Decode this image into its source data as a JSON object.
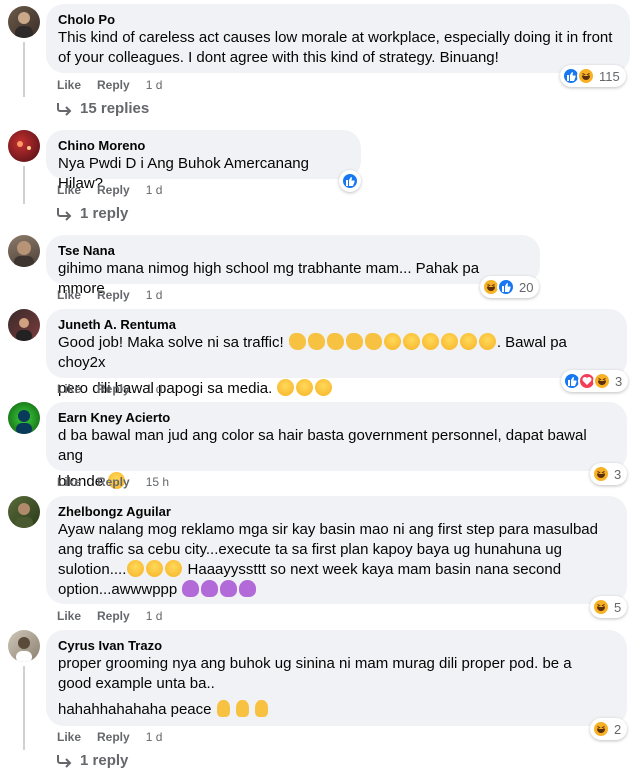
{
  "colors": {
    "bubble": "#f0f2f5",
    "secondary_text": "#65676b",
    "like_blue": "#1877f2",
    "love_red": "#f33e58",
    "haha_yellow": "#f7b125"
  },
  "comments": [
    {
      "author": "Cholo Po",
      "lines": [
        "This kind of careless act causes low morale at workplace, especially doing it in front of your colleagues. I dont agree with this kind of strategy. Binuang!"
      ],
      "like": "Like",
      "reply": "Reply",
      "time": "1 d",
      "reactions": {
        "icons": [
          "like-icon",
          "haha-icon"
        ],
        "count": "115"
      },
      "replies": "15 replies"
    },
    {
      "author": "Chino Moreno",
      "lines": [
        "Nya Pwdi D i Ang Buhok Amercanang Hilaw?"
      ],
      "like": "Like",
      "reply": "Reply",
      "time": "1 d",
      "reactions": {
        "icons": [
          "like-icon"
        ],
        "count": ""
      },
      "replies": "1 reply"
    },
    {
      "author": "Tse Nana",
      "lines": [
        "gihimo mana nimog high school mg trabhante mam... Pahak pa mmore"
      ],
      "like": "Like",
      "reply": "Reply",
      "time": "1 d",
      "reactions": {
        "icons": [
          "haha-icon",
          "like-icon"
        ],
        "count": "20"
      }
    },
    {
      "author": "Juneth A. Rentuma",
      "line1_text": "Good job! Maka solve ni sa traffic!",
      "line1_suffix": ". Bawal pa choy2x",
      "line2_text": "pero dili bawal papogi sa media.",
      "like": "Like",
      "reply": "Reply",
      "time": "1 d",
      "reactions": {
        "icons": [
          "like-icon",
          "love-icon",
          "haha-icon"
        ],
        "count": "3"
      }
    },
    {
      "author": "Earn Kney Acierto",
      "lines": [
        "d ba bawal man jud ang color sa hair basta government personnel, dapat bawal ang",
        "blonde"
      ],
      "like": "Like",
      "reply": "Reply",
      "time": "15 h",
      "reactions": {
        "icons": [
          "haha-icon"
        ],
        "count": "3"
      }
    },
    {
      "author": "Zhelbongz Aguilar",
      "lines": [
        "Ayaw nalang mog reklamo mga sir kay basin mao ni ang first step para masulbad",
        "ang traffic sa cebu city...execute ta sa first plan kapoy baya ug hunahuna ug"
      ],
      "line3_text": "sulotion....",
      "line3_suffix": " Haaayyssttt so next week kaya mam basin nana second",
      "line4_text": "option...awwwppp",
      "like": "Like",
      "reply": "Reply",
      "time": "1 d",
      "reactions": {
        "icons": [
          "haha-icon"
        ],
        "count": "5"
      }
    },
    {
      "author": "Cyrus Ivan Trazo",
      "lines": [
        "proper grooming nya ang buhok ug sinina ni mam murag dili proper pod. be a",
        "good example unta ba.."
      ],
      "line3_text": "hahahhahahaha peace",
      "like": "Like",
      "reply": "Reply",
      "time": "1 d",
      "reactions": {
        "icons": [
          "haha-icon"
        ],
        "count": "2"
      },
      "replies": "1 reply"
    }
  ]
}
